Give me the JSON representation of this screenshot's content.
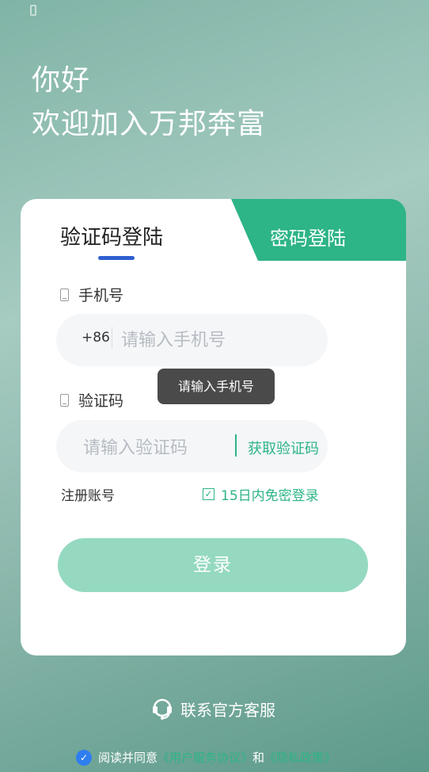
{
  "greeting": {
    "line1": "你好",
    "line2": "欢迎加入万邦奔富"
  },
  "tabs": {
    "active_label": "验证码登陆",
    "inactive_label": "密码登陆"
  },
  "phone": {
    "label": "手机号",
    "prefix": "+86",
    "placeholder": "请输入手机号"
  },
  "toast": {
    "text": "请输入手机号"
  },
  "code": {
    "label": "验证码",
    "placeholder": "请输入验证码",
    "get_code": "获取验证码"
  },
  "links": {
    "register": "注册账号",
    "remember": "15日内免密登录",
    "remember_checked": true
  },
  "login": {
    "label": "登录"
  },
  "footer": {
    "service": "联系官方客服",
    "agree_prefix": "阅读并同意",
    "terms": "《用户服务协议》",
    "and": "和",
    "privacy": "《隐私政策》"
  },
  "colors": {
    "brand_green": "#2db487",
    "button_disabled": "#94d9c0",
    "tab_underline": "#2f5fd0",
    "checkbox_blue": "#2f7ef0"
  }
}
